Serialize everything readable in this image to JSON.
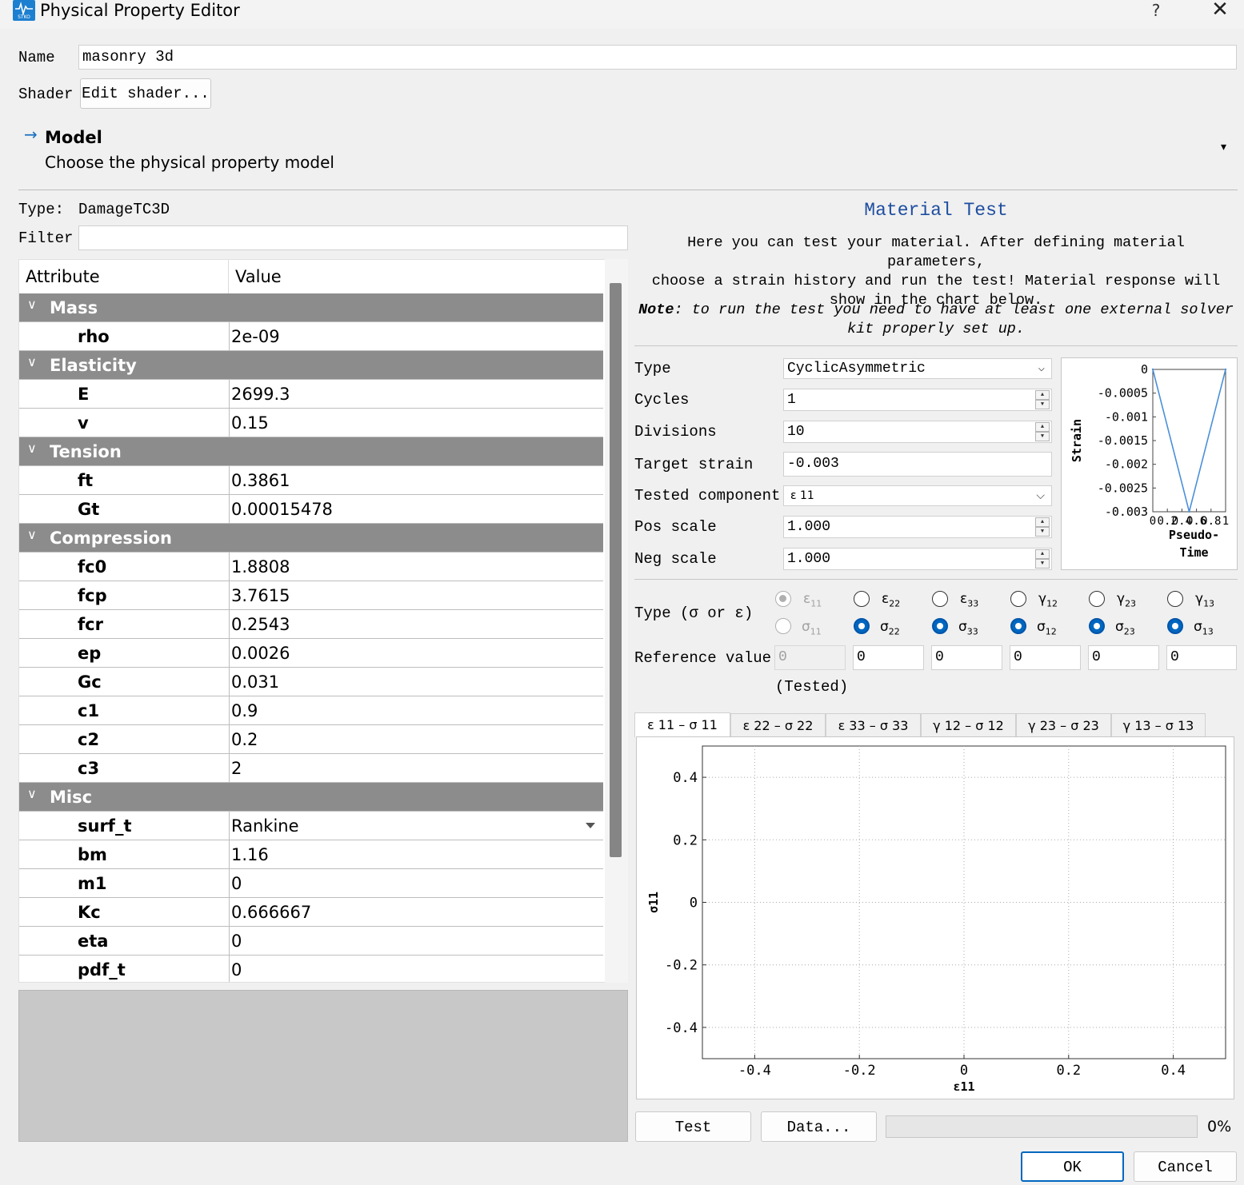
{
  "window": {
    "title": "Physical Property Editor",
    "help": "?",
    "close": "✕"
  },
  "name": {
    "label": "Name",
    "value": "masonry 3d"
  },
  "shader": {
    "label": "Shader",
    "button": "Edit shader..."
  },
  "model": {
    "arrow": "→",
    "title": "Model",
    "subtitle": "Choose the physical property model",
    "dropdown": "▾"
  },
  "type_row": {
    "label": "Type:",
    "value": "DamageTC3D"
  },
  "filter": {
    "label": "Filter",
    "value": ""
  },
  "table": {
    "headers": [
      "Attribute",
      "Value"
    ],
    "groups": [
      {
        "name": "Mass",
        "rows": [
          {
            "attr": "rho",
            "value": "2e-09"
          }
        ]
      },
      {
        "name": "Elasticity",
        "rows": [
          {
            "attr": "E",
            "value": "2699.3"
          },
          {
            "attr": "v",
            "value": "0.15"
          }
        ]
      },
      {
        "name": "Tension",
        "rows": [
          {
            "attr": "ft",
            "value": "0.3861"
          },
          {
            "attr": "Gt",
            "value": "0.00015478"
          }
        ]
      },
      {
        "name": "Compression",
        "rows": [
          {
            "attr": "fc0",
            "value": "1.8808"
          },
          {
            "attr": "fcp",
            "value": "3.7615"
          },
          {
            "attr": "fcr",
            "value": "0.2543"
          },
          {
            "attr": "ep",
            "value": "0.0026"
          },
          {
            "attr": "Gc",
            "value": "0.031"
          },
          {
            "attr": "c1",
            "value": "0.9"
          },
          {
            "attr": "c2",
            "value": "0.2"
          },
          {
            "attr": "c3",
            "value": "2"
          }
        ]
      },
      {
        "name": "Misc",
        "rows": [
          {
            "attr": "surf_t",
            "value": "Rankine",
            "dropdown": true
          },
          {
            "attr": "bm",
            "value": "1.16"
          },
          {
            "attr": "m1",
            "value": "0"
          },
          {
            "attr": "Kc",
            "value": "0.666667"
          },
          {
            "attr": "eta",
            "value": "0"
          },
          {
            "attr": "pdf_t",
            "value": "0"
          }
        ]
      }
    ]
  },
  "test": {
    "title": "Material Test",
    "intro": [
      "Here you can test your material. After defining material parameters,",
      "choose a strain history and run the test! Material response will",
      "show in the chart below."
    ],
    "note_label": "Note",
    "note_rest": ": to run the test you need to have at least one external solver",
    "note_line2": "kit properly set up.",
    "type": {
      "label": "Type",
      "value": "CyclicAsymmetric"
    },
    "cycles": {
      "label": "Cycles",
      "value": "1"
    },
    "divisions": {
      "label": "Divisions",
      "value": "10"
    },
    "target": {
      "label": "Target strain",
      "value": "-0.003"
    },
    "component": {
      "label": "Tested component",
      "value": "ε 11"
    },
    "pos": {
      "label": "Pos scale",
      "value": "1.000"
    },
    "neg": {
      "label": "Neg scale",
      "value": "1.000"
    },
    "type_se_label": "Type (σ or ε)",
    "ref_label": "Reference value",
    "ref_values": [
      "0",
      "0",
      "0",
      "0",
      "0",
      "0"
    ],
    "tested_label": "(Tested)",
    "eps_labels": [
      "ε",
      "ε",
      "ε",
      "γ",
      "γ",
      "γ"
    ],
    "sig_labels": [
      "σ",
      "σ",
      "σ",
      "σ",
      "σ",
      "σ"
    ],
    "idx": [
      "11",
      "22",
      "33",
      "12",
      "23",
      "13"
    ],
    "tabs": [
      "ε 11 – σ 11",
      "ε 22 – σ 22",
      "ε 33 – σ 33",
      "γ 12 – σ 12",
      "γ 23 – σ 23",
      "γ 13 – σ 13"
    ],
    "test_button": "Test",
    "data_button": "Data...",
    "progress": {
      "percent": 0,
      "label": "0%"
    }
  },
  "buttons": {
    "ok": "OK",
    "cancel": "Cancel"
  },
  "chart_data": [
    {
      "type": "line",
      "xlabel": "Pseudo-Time",
      "ylabel": "Strain",
      "x": [
        0,
        0.5,
        1
      ],
      "y": [
        0,
        -0.003,
        0
      ],
      "x_ticks": [
        "0",
        "0.2",
        "0.4",
        "0.6",
        "0.8",
        "1"
      ],
      "y_ticks": [
        "0",
        "-0.0005",
        "-0.001",
        "-0.0015",
        "-0.002",
        "-0.0025",
        "-0.003"
      ],
      "xlim": [
        0,
        1
      ],
      "ylim": [
        -0.003,
        0
      ],
      "color": "#4a90d9"
    },
    {
      "type": "scatter",
      "xlabel": "ε11",
      "ylabel": "σ11",
      "x_ticks": [
        "-0.4",
        "-0.2",
        "0",
        "0.2",
        "0.4"
      ],
      "y_ticks": [
        "0.4",
        "0.2",
        "0",
        "-0.2",
        "-0.4"
      ],
      "xlim": [
        -0.5,
        0.5
      ],
      "ylim": [
        -0.5,
        0.5
      ],
      "grid": true,
      "series": []
    }
  ]
}
